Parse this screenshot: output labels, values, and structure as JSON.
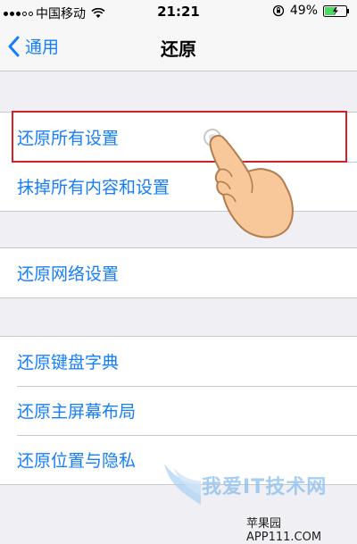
{
  "status_bar": {
    "carrier": "中国移动",
    "time": "21:21",
    "battery_percent": "49%",
    "battery_level": 0.49,
    "signal_bars_filled": 3,
    "signal_bars_total": 5
  },
  "nav": {
    "back_label": "通用",
    "title": "还原"
  },
  "groups": [
    {
      "items": [
        "还原所有设置",
        "抹掉所有内容和设置"
      ]
    },
    {
      "items": [
        "还原网络设置"
      ]
    },
    {
      "items": [
        "还原键盘字典",
        "还原主屏幕布局",
        "还原位置与隐私"
      ]
    }
  ],
  "watermark": {
    "title": "我爱IT技术网",
    "subtitle": "苹果园 APP111.COM"
  },
  "colors": {
    "accent": "#157efb",
    "highlight": "#d0212a",
    "background": "#efeff4"
  }
}
